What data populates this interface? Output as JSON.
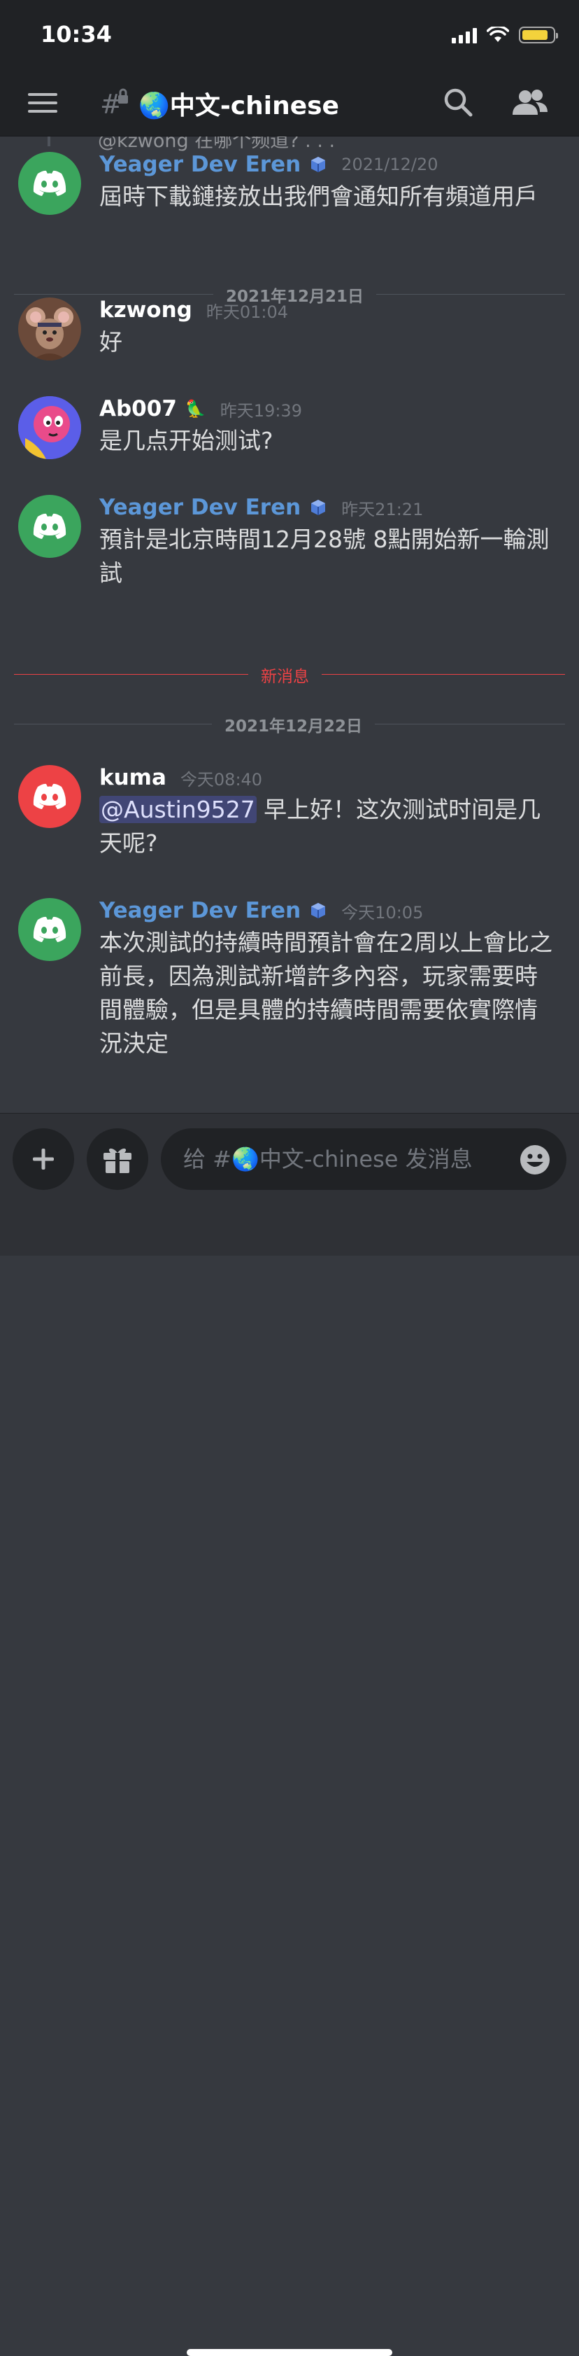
{
  "status_bar": {
    "time": "10:34",
    "battery_level": 0.85
  },
  "header": {
    "channel_name": "🌏中文-chinese"
  },
  "reply_preview": {
    "text": "@kzwong 在哪个频道? . . ."
  },
  "messages": [
    {
      "author": "Yeager Dev Eren",
      "timestamp": "2021/12/20",
      "text": "屆時下載鏈接放出我們會通知所有頻道用戶"
    },
    {
      "author": "kzwong",
      "timestamp": "昨天01:04",
      "text": "好"
    },
    {
      "author": "Ab007",
      "timestamp": "昨天19:39",
      "text": "是几点开始测试?",
      "badge": "🦜"
    },
    {
      "author": "Yeager Dev Eren",
      "timestamp": "昨天21:21",
      "text": "預計是北京時間12月28號 8點開始新一輪測試"
    },
    {
      "author": "kuma",
      "timestamp": "今天08:40",
      "mention": "@Austin9527",
      "text": " 早上好！这次测试时间是几天呢?"
    },
    {
      "author": "Yeager Dev Eren",
      "timestamp": "今天10:05",
      "text": "本次測試的持續時間預計會在2周以上會比之前長，因為測試新增許多內容，玩家需要時間體驗，但是具體的持續時間需要依實際情況決定"
    }
  ],
  "dividers": {
    "date_1": "2021年12月21日",
    "new_messages": "新消息",
    "date_2": "2021年12月22日"
  },
  "composer": {
    "placeholder": "给 #🌏中文-chinese 发消息"
  },
  "colors": {
    "background": "#36393f",
    "header": "#202225",
    "dev_name": "#5c97d8",
    "new_divider": "#ed4245",
    "mention_bg": "#414675"
  }
}
